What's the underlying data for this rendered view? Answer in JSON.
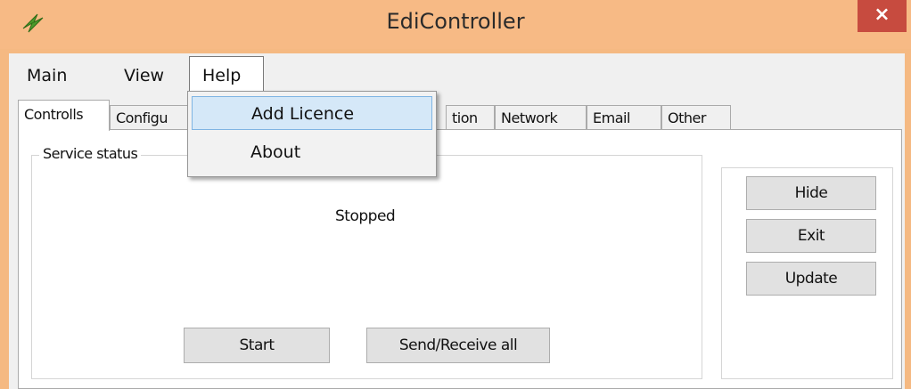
{
  "window": {
    "title": "EdiController",
    "close_label": "×",
    "icon": "lightning-bolt-icon"
  },
  "menubar": {
    "items": [
      {
        "label": "Main"
      },
      {
        "label": "View"
      },
      {
        "label": "Help"
      }
    ]
  },
  "help_menu": {
    "items": [
      {
        "label": "Add Licence",
        "highlighted": true
      },
      {
        "label": "About",
        "highlighted": false
      }
    ]
  },
  "tabs": [
    {
      "label": "Controlls",
      "active": true
    },
    {
      "label": "Configu",
      "active": false
    },
    {
      "label": "tion",
      "active": false
    },
    {
      "label": "Network",
      "active": false
    },
    {
      "label": "Email",
      "active": false
    },
    {
      "label": "Other",
      "active": false
    }
  ],
  "service": {
    "group_label": "Service status",
    "status": "Stopped",
    "start_label": "Start",
    "send_receive_label": "Send/Receive all"
  },
  "side_buttons": {
    "hide_label": "Hide",
    "exit_label": "Exit",
    "update_label": "Update"
  },
  "colors": {
    "titlebar": "#f7ba85",
    "close": "#c74b3f",
    "highlight": "#d5e8f8"
  }
}
